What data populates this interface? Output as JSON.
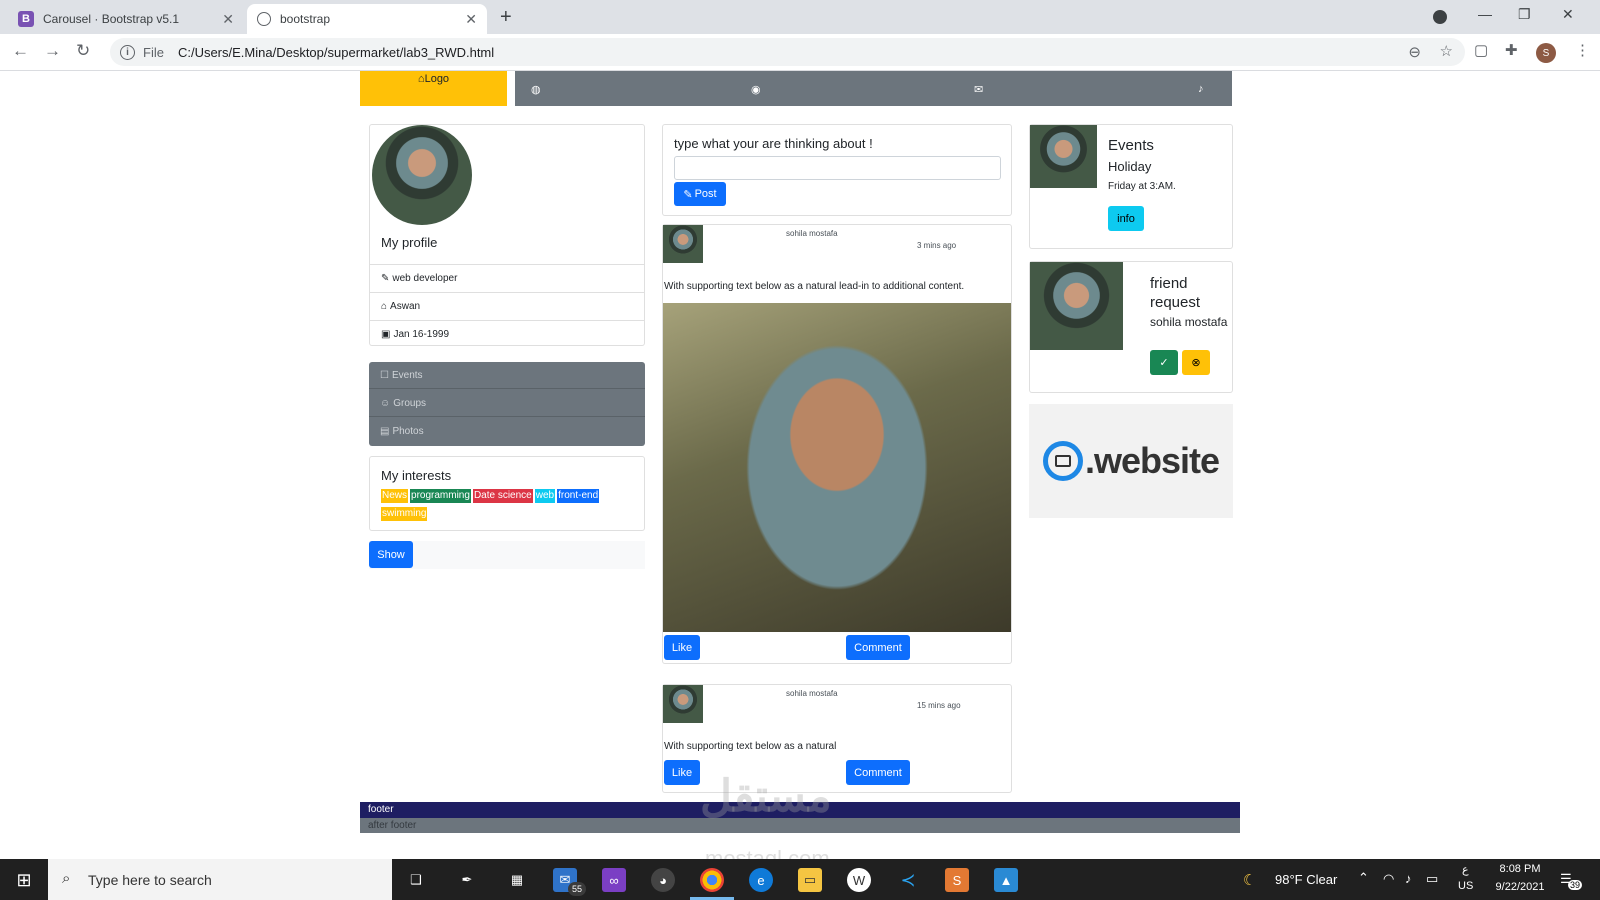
{
  "browser": {
    "tabs": [
      {
        "title": "Carousel · Bootstrap v5.1",
        "favicon": "B"
      },
      {
        "title": "bootstrap",
        "favicon": "globe-icon"
      }
    ],
    "file_label": "File",
    "url": "C:/Users/E.Mina/Desktop/supermarket/lab3_RWD.html",
    "profile_initial": "S"
  },
  "nav": {
    "logo_label": "Logo"
  },
  "profile": {
    "title": "My profile",
    "job": "web developer",
    "city": "Aswan",
    "birthday": "Jan 16-1999",
    "menu": [
      "Events",
      "Groups",
      "Photos"
    ],
    "interests_title": "My interests",
    "interests": [
      {
        "label": "News",
        "color": "#ffc107"
      },
      {
        "label": "programming",
        "color": "#198754"
      },
      {
        "label": "Date science",
        "color": "#dc3545"
      },
      {
        "label": "web",
        "color": "#0dcaf0"
      },
      {
        "label": "front-end",
        "color": "#0d6efd"
      },
      {
        "label": "swimming",
        "color": "#ffc107"
      }
    ],
    "show_button": "Show"
  },
  "composer": {
    "prompt": "type what your are thinking about !",
    "post_button": "Post"
  },
  "posts": [
    {
      "author": "sohila mostafa",
      "time": "3 mins ago",
      "text": "With supporting text below as a natural lead-in to additional content.",
      "like": "Like",
      "comment": "Comment"
    },
    {
      "author": "sohila mostafa",
      "time": "15 mins ago",
      "text": "With supporting text below as a natural",
      "like": "Like",
      "comment": "Comment"
    }
  ],
  "events": {
    "title": "Events",
    "subtitle": "Holiday",
    "when": "Friday at 3:AM.",
    "info_button": "info"
  },
  "friend_request": {
    "title": "friend request",
    "name": "sohila mostafa"
  },
  "ad": {
    "text": ".website"
  },
  "footer": {
    "text": "footer",
    "after_text": "after footer"
  },
  "watermark": {
    "arabic": "مستقل",
    "latin": "mostaql.com"
  },
  "taskbar": {
    "search_placeholder": "Type here to search",
    "mail_badge": "55",
    "weather": "98°F  Clear",
    "lang_top": "ع",
    "lang_bottom": "US",
    "time": "8:08 PM",
    "date": "9/22/2021",
    "notifications": "39"
  },
  "colors": {
    "accent": "#0d6efd",
    "logo_bg": "#ffc107",
    "nav_bg": "#6c757d",
    "footer_bg": "#1e1e62"
  }
}
